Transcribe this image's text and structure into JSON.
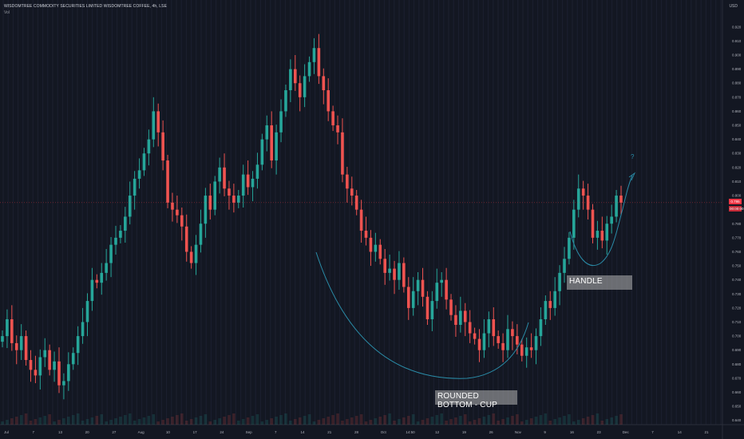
{
  "header": {
    "title": "WISDOMTREE COMMODITY SECURITIES LIMITED WISDOMTREE COFFEE, 4h, LSE",
    "indicator": "Vol",
    "currency": "USD"
  },
  "annotations": {
    "handle": "HANDLE",
    "cup": "ROUNDED BOTTOM - CUP",
    "question": "?"
  },
  "price_badge": {
    "price": "0.795",
    "countdown": "00:00:00"
  },
  "colors": {
    "background": "#131722",
    "up": "#26a69a",
    "down": "#ef5350",
    "annotation_line": "#2a8ca8",
    "price_line": "#f23645"
  },
  "chart_data": {
    "type": "candlestick",
    "yaxis": {
      "ticks": [
        "0.920",
        "0.910",
        "0.900",
        "0.890",
        "0.880",
        "0.870",
        "0.860",
        "0.850",
        "0.840",
        "0.830",
        "0.820",
        "0.810",
        "0.800",
        "0.790",
        "0.780",
        "0.770",
        "0.760",
        "0.750",
        "0.740",
        "0.730",
        "0.720",
        "0.710",
        "0.700",
        "0.690",
        "0.680",
        "0.670",
        "0.660",
        "0.650",
        "0.640"
      ],
      "range": [
        0.637,
        0.925
      ]
    },
    "xaxis": {
      "ticks": [
        "Jul",
        "7",
        "13",
        "20",
        "27",
        "Aug",
        "10",
        "17",
        "24",
        "Sep",
        "7",
        "14",
        "21",
        "28",
        "Oct",
        "14:50",
        "12",
        "19",
        "26",
        "Nov",
        "9",
        "16",
        "23",
        "Dec",
        "7",
        "14",
        "21"
      ],
      "ranges": "Jul – Dec"
    },
    "last_price": 0.795,
    "closes": [
      0.7,
      0.712,
      0.695,
      0.69,
      0.7,
      0.683,
      0.676,
      0.672,
      0.685,
      0.69,
      0.676,
      0.682,
      0.665,
      0.668,
      0.68,
      0.688,
      0.7,
      0.71,
      0.725,
      0.74,
      0.738,
      0.745,
      0.752,
      0.765,
      0.77,
      0.775,
      0.785,
      0.8,
      0.812,
      0.818,
      0.83,
      0.84,
      0.86,
      0.845,
      0.825,
      0.795,
      0.79,
      0.786,
      0.778,
      0.76,
      0.752,
      0.765,
      0.78,
      0.8,
      0.79,
      0.81,
      0.82,
      0.805,
      0.8,
      0.795,
      0.8,
      0.815,
      0.806,
      0.812,
      0.822,
      0.84,
      0.85,
      0.825,
      0.845,
      0.86,
      0.875,
      0.89,
      0.88,
      0.87,
      0.885,
      0.895,
      0.905,
      0.885,
      0.875,
      0.86,
      0.85,
      0.845,
      0.815,
      0.805,
      0.8,
      0.79,
      0.775,
      0.77,
      0.76,
      0.765,
      0.755,
      0.745,
      0.748,
      0.74,
      0.752,
      0.735,
      0.72,
      0.732,
      0.74,
      0.728,
      0.712,
      0.725,
      0.738,
      0.74,
      0.726,
      0.715,
      0.708,
      0.718,
      0.71,
      0.702,
      0.698,
      0.69,
      0.702,
      0.712,
      0.7,
      0.695,
      0.69,
      0.705,
      0.7,
      0.694,
      0.686,
      0.692,
      0.69,
      0.7,
      0.712,
      0.725,
      0.72,
      0.732,
      0.745,
      0.755,
      0.77,
      0.79,
      0.805,
      0.8,
      0.79,
      0.77,
      0.775,
      0.768,
      0.78,
      0.785,
      0.8,
      0.795
    ]
  }
}
